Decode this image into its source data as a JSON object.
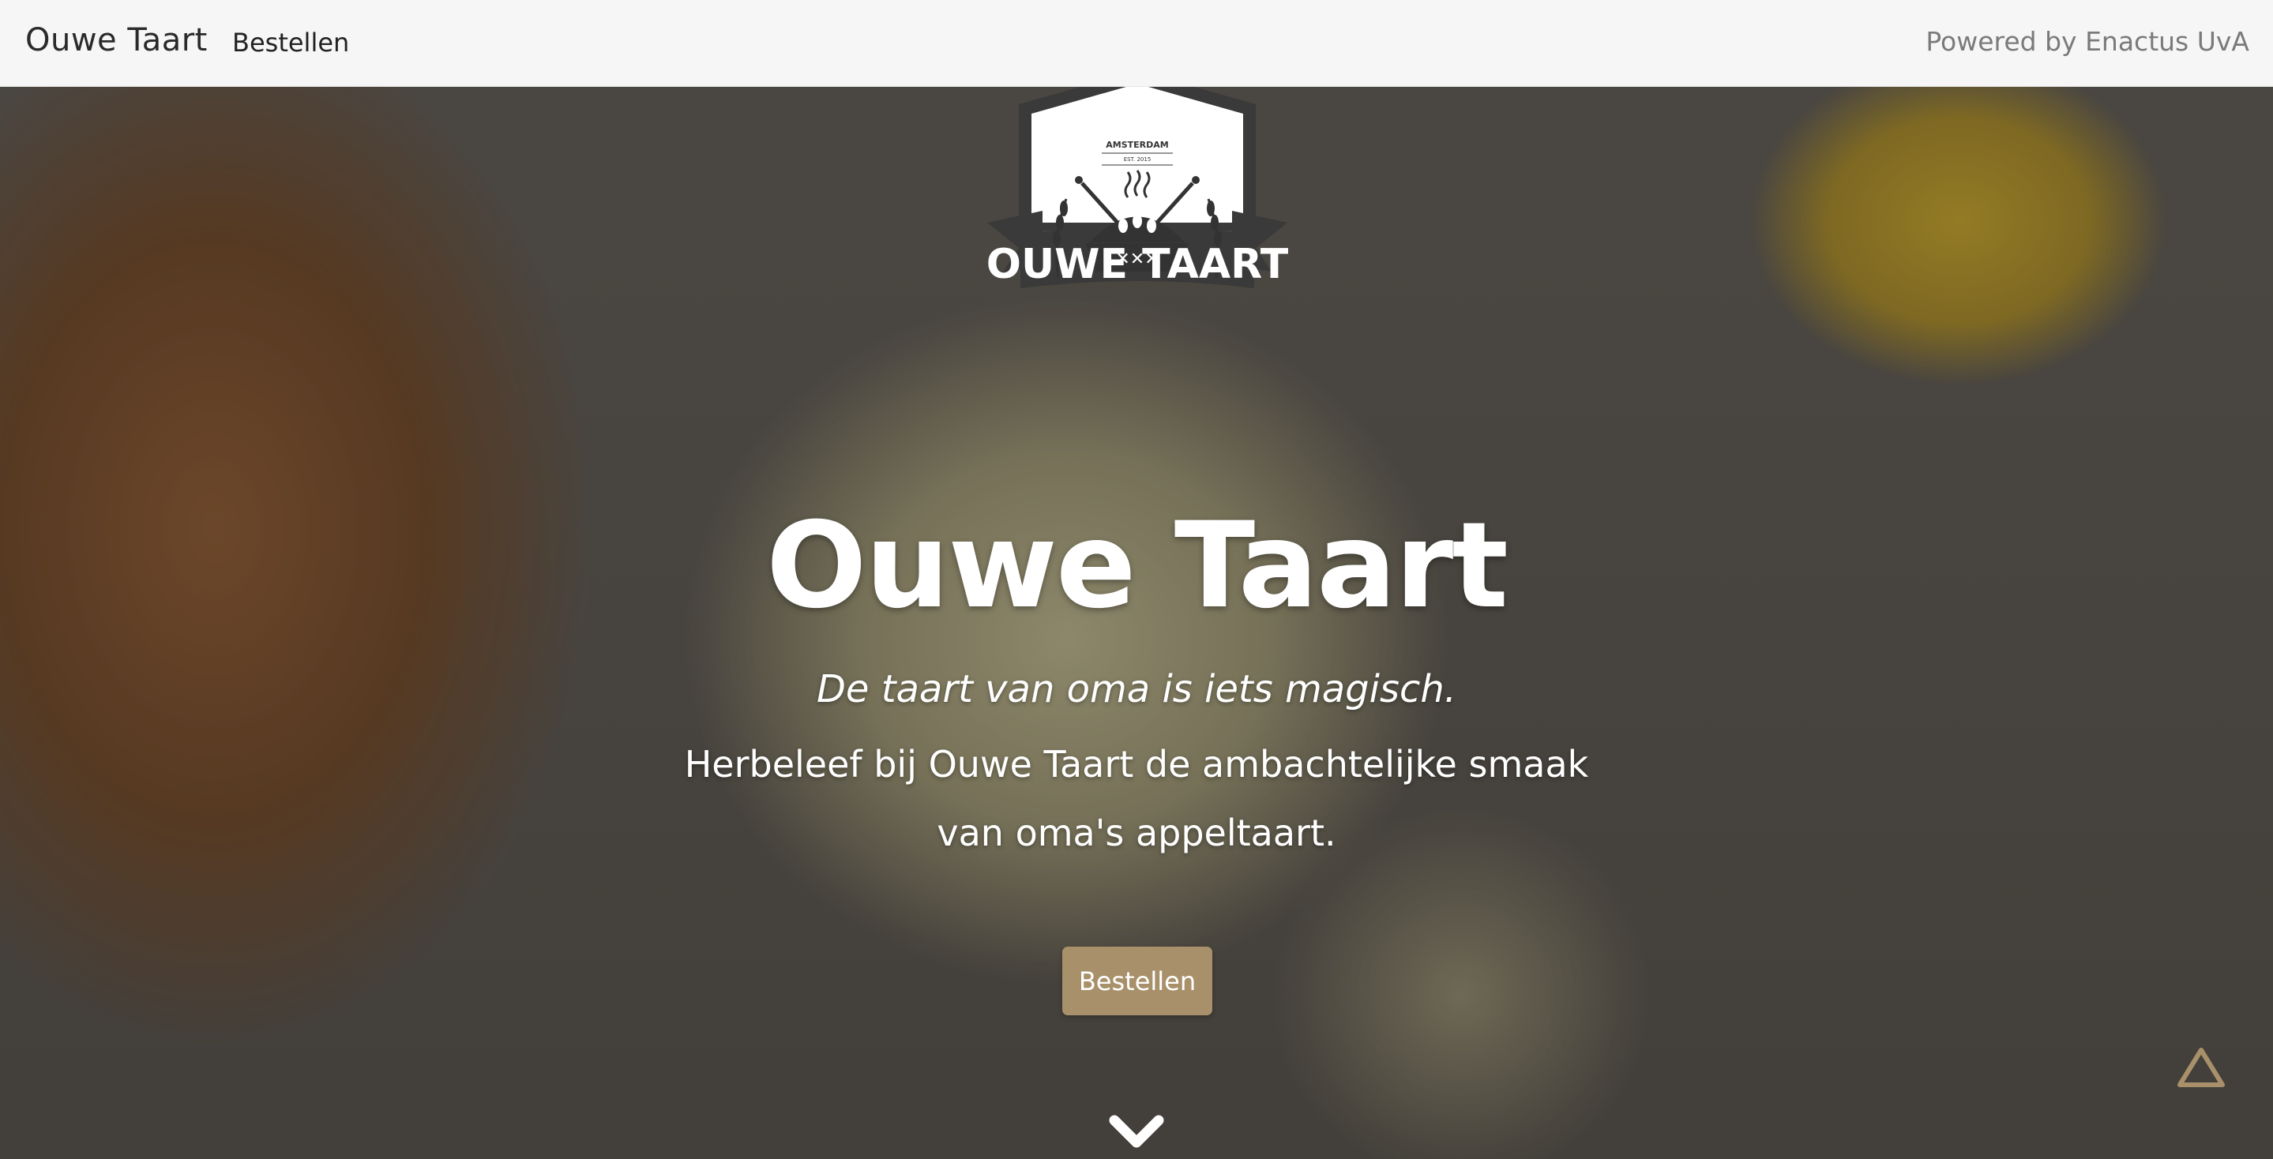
{
  "navbar": {
    "brand": "Ouwe Taart",
    "link_order": "Bestellen",
    "powered_by": "Powered by Enactus UvA"
  },
  "hero": {
    "logo": {
      "top_text": "AMSTERDAM",
      "est_text": "EST. 2015",
      "banner_text": "OUWE TAART"
    },
    "title": "Ouwe Taart",
    "tagline": "De taart van oma is iets magisch.",
    "description": "Herbeleef bij Ouwe Taart de ambachtelijke smaak van oma's appeltaart.",
    "button_label": "Bestellen",
    "scroll_icon": "chevron-down-icon",
    "back_to_top_icon": "triangle-up-icon"
  },
  "colors": {
    "navbar_bg": "#f6f6f6",
    "button_bg": "#a8916a",
    "back_to_top": "#a8916a",
    "text_on_hero": "#ffffff"
  }
}
